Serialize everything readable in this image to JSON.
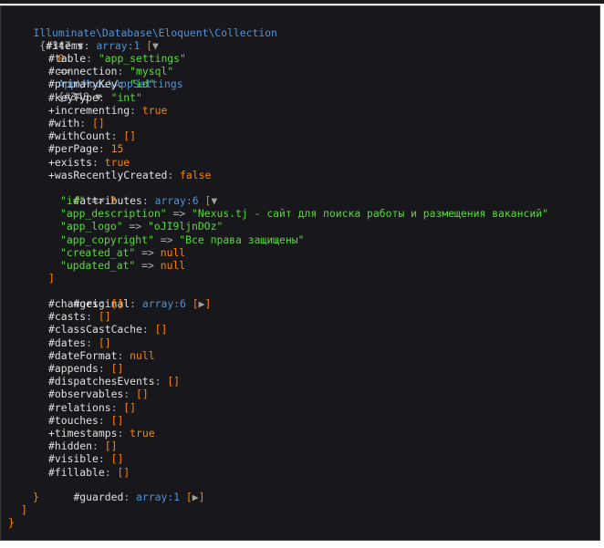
{
  "root": {
    "class": "Illuminate\\Database\\Eloquent\\Collection",
    "hash": "#347",
    "toggle_expanded": "▼",
    "open": "{",
    "close": "}"
  },
  "items": {
    "key": "#items",
    "type": "array:1",
    "open": "[",
    "toggle": "▼",
    "close": "]"
  },
  "model": {
    "index": "0",
    "arrow": "=>",
    "class": "App\\Mod…\\AppSettings",
    "hash": "#348",
    "toggle": "▼",
    "open": "{",
    "close": "}",
    "props": [
      {
        "key": "#table",
        "val": "\"app_settings\"",
        "kind": "str"
      },
      {
        "key": "#connection",
        "val": "\"mysql\"",
        "kind": "str"
      },
      {
        "key": "#primaryKey",
        "val": "\"id\"",
        "kind": "str"
      },
      {
        "key": "#keyType",
        "val": "\"int\"",
        "kind": "str"
      },
      {
        "key": "+incrementing",
        "val": "true",
        "kind": "bool"
      },
      {
        "key": "#with",
        "val": "[]",
        "kind": "br"
      },
      {
        "key": "#withCount",
        "val": "[]",
        "kind": "br"
      },
      {
        "key": "#perPage",
        "val": "15",
        "kind": "num"
      },
      {
        "key": "+exists",
        "val": "true",
        "kind": "bool"
      },
      {
        "key": "+wasRecentlyCreated",
        "val": "false",
        "kind": "bool"
      }
    ]
  },
  "attributes": {
    "key": "#attributes",
    "type": "array:6",
    "open": "[",
    "toggle": "▼",
    "close": "]",
    "entries": [
      {
        "key": "\"id\"",
        "val": "2",
        "kind": "num"
      },
      {
        "key": "\"app_description\"",
        "val": "\"Nexus.tj - сайт для поиска работы и размещения вакансий\"",
        "kind": "str"
      },
      {
        "key": "\"app_logo\"",
        "val": "\"oJI9ljnDOz\"",
        "kind": "str"
      },
      {
        "key": "\"app_copyright\"",
        "val": "\"Все права защищены\"",
        "kind": "str"
      },
      {
        "key": "\"created_at\"",
        "val": "null",
        "kind": "bool"
      },
      {
        "key": "\"updated_at\"",
        "val": "null",
        "kind": "bool"
      }
    ]
  },
  "original": {
    "key": "#original",
    "type": "array:6",
    "open": "[",
    "toggle": "▶",
    "close": "]"
  },
  "more_props": [
    {
      "key": "#changes",
      "val": "[]",
      "kind": "br"
    },
    {
      "key": "#casts",
      "val": "[]",
      "kind": "br"
    },
    {
      "key": "#classCastCache",
      "val": "[]",
      "kind": "br"
    },
    {
      "key": "#dates",
      "val": "[]",
      "kind": "br"
    },
    {
      "key": "#dateFormat",
      "val": "null",
      "kind": "bool"
    },
    {
      "key": "#appends",
      "val": "[]",
      "kind": "br"
    },
    {
      "key": "#dispatchesEvents",
      "val": "[]",
      "kind": "br"
    },
    {
      "key": "#observables",
      "val": "[]",
      "kind": "br"
    },
    {
      "key": "#relations",
      "val": "[]",
      "kind": "br"
    },
    {
      "key": "#touches",
      "val": "[]",
      "kind": "br"
    },
    {
      "key": "+timestamps",
      "val": "true",
      "kind": "bool"
    },
    {
      "key": "#hidden",
      "val": "[]",
      "kind": "br"
    },
    {
      "key": "#visible",
      "val": "[]",
      "kind": "br"
    },
    {
      "key": "#fillable",
      "val": "[]",
      "kind": "br"
    }
  ],
  "guarded": {
    "key": "#guarded",
    "type": "array:1",
    "open": "[",
    "toggle": "▶",
    "close": "]"
  },
  "punct": {
    "colon": ": ",
    "arrow": " => ",
    "space": " "
  }
}
